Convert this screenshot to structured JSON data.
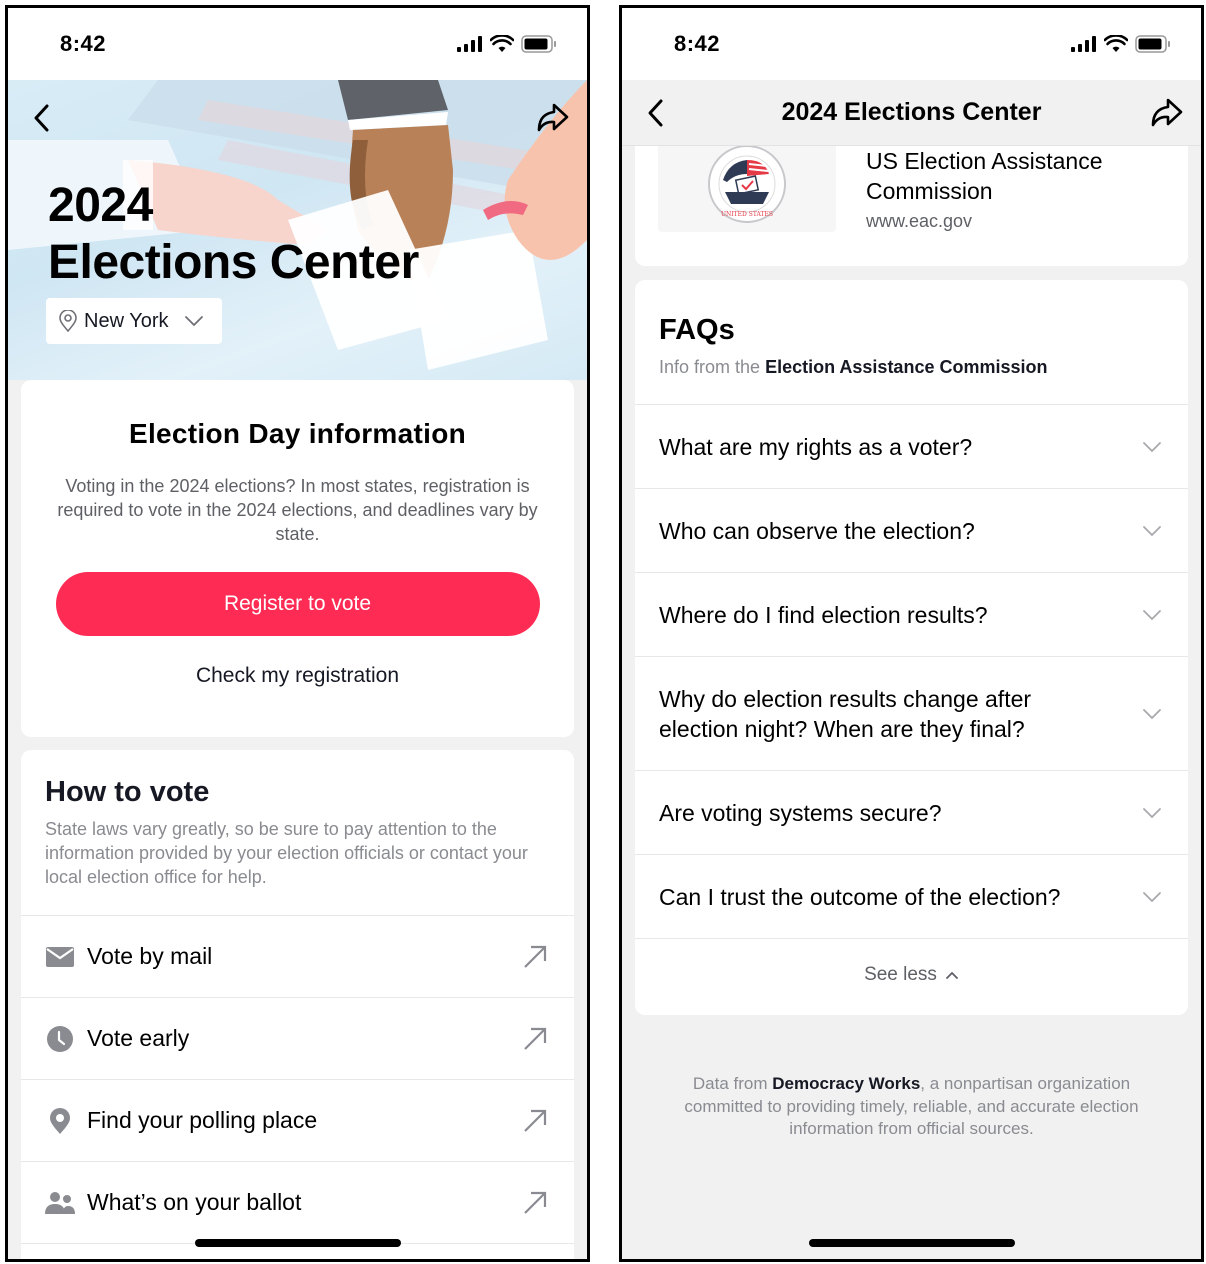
{
  "colors": {
    "accent": "#fe2c55",
    "text_primary": "#161823",
    "text_secondary": "#8a8b91",
    "background": "#f1f1f2",
    "card": "#ffffff"
  },
  "left_screen": {
    "status_bar": {
      "time": "8:42",
      "icons": [
        "signal-icon",
        "wifi-icon",
        "battery-icon"
      ]
    },
    "hero": {
      "title_line1": "2024",
      "title_line2": "Elections Center",
      "back_icon": "chevron-left-icon",
      "share_icon": "share-arrow-icon",
      "location": {
        "icon": "location-pin-icon",
        "value": "New York",
        "dropdown_icon": "chevron-down-icon"
      }
    },
    "election_day": {
      "title": "Election Day information",
      "description": "Voting in the 2024 elections? In most states, registration is required to vote in the 2024 elections, and deadlines vary by state.",
      "register_button": "Register to vote",
      "check_link": "Check my registration"
    },
    "how_to_vote": {
      "title": "How to vote",
      "description": "State laws vary greatly, so be sure to pay attention to the information provided by your election officials or contact your local election office for help.",
      "items": [
        {
          "label": "Vote by mail",
          "icon": "mail-icon",
          "action_icon": "external-arrow-icon"
        },
        {
          "label": "Vote early",
          "icon": "clock-icon",
          "action_icon": "external-arrow-icon"
        },
        {
          "label": "Find your polling place",
          "icon": "location-pin-icon",
          "action_icon": "external-arrow-icon"
        },
        {
          "label": "What’s on your ballot",
          "icon": "people-icon",
          "action_icon": "external-arrow-icon"
        }
      ]
    }
  },
  "right_screen": {
    "status_bar": {
      "time": "8:42",
      "icons": [
        "signal-icon",
        "wifi-icon",
        "battery-icon"
      ]
    },
    "nav": {
      "title": "2024 Elections Center",
      "back_icon": "chevron-left-icon",
      "share_icon": "share-arrow-icon"
    },
    "source": {
      "name": "US Election Assistance Commission",
      "url": "www.eac.gov",
      "logo": "eac-seal-logo"
    },
    "faqs": {
      "title": "FAQs",
      "subtitle_prefix": "Info from the ",
      "subtitle_source": "Election Assistance Commission",
      "items": [
        {
          "question": "What are my rights as a voter?"
        },
        {
          "question": "Who can observe the election?"
        },
        {
          "question": "Where do I find election results?"
        },
        {
          "question": "Why do election results change after election night? When are they final?"
        },
        {
          "question": "Are voting systems secure?"
        },
        {
          "question": "Can I trust the outcome of the election?"
        }
      ],
      "see_less": "See less"
    },
    "footer": {
      "prefix": "Data from ",
      "source": "Democracy Works",
      "suffix": ", a nonpartisan organization committed to providing timely, reliable, and accurate election information from official sources."
    }
  }
}
